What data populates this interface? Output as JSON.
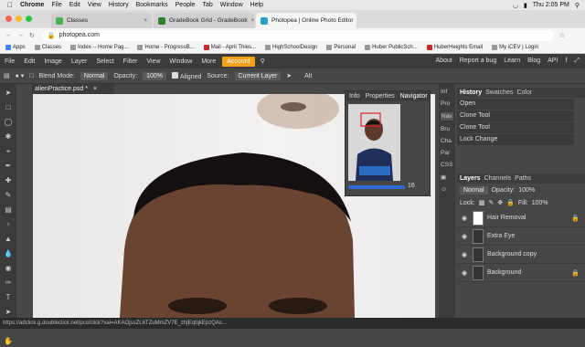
{
  "mac_menu": {
    "app": "Chrome",
    "items": [
      "File",
      "Edit",
      "View",
      "History",
      "Bookmarks",
      "People",
      "Tab",
      "Window",
      "Help"
    ],
    "clock": "Thu 2:05 PM"
  },
  "tabs": [
    {
      "label": "Classes",
      "color": "#4caf50"
    },
    {
      "label": "GradeBook Grid - GradeBook",
      "color": "#2e7d32"
    },
    {
      "label": "Photopea | Online Photo Editor",
      "color": "#27a0c8"
    }
  ],
  "url": "photopea.com",
  "bookmarks": [
    "Apps",
    "Classes",
    "Index -- Home Pag...",
    "Home - ProgressB...",
    "Mail - April Thies...",
    "HighSchoolDesign",
    "Personal",
    "Huber PublicSch...",
    "HuberHeights Email",
    "My iCEV | Login"
  ],
  "menu": {
    "items": [
      "File",
      "Edit",
      "Image",
      "Layer",
      "Select",
      "Filter",
      "View",
      "Window",
      "More"
    ],
    "account": "Account",
    "right": [
      "About",
      "Report a bug",
      "Learn",
      "Blog",
      "API"
    ]
  },
  "options": {
    "blend_label": "Blend Mode:",
    "blend_value": "Normal",
    "opacity_label": "Opacity:",
    "opacity_value": "100%",
    "aligned": "Aligned",
    "source_label": "Source:",
    "source_value": "Current Layer",
    "alt": "Alt"
  },
  "document_tab": "alienPractice.psd *",
  "navigator": {
    "tabs": [
      "Info",
      "Properties",
      "Navigator"
    ],
    "zoom": "16"
  },
  "side_icons": [
    "Inf",
    "Pro",
    "Nav",
    "Bru",
    "Cha",
    "Par",
    "CSS"
  ],
  "history": {
    "tabs": [
      "History",
      "Swatches",
      "Color"
    ],
    "items": [
      "Open",
      "Clone Tool",
      "Clone Tool",
      "Lock Change"
    ]
  },
  "layers": {
    "tabs": [
      "Layers",
      "Channels",
      "Paths"
    ],
    "blend": "Normal",
    "opacity_label": "Opacity:",
    "opacity": "100%",
    "lock_label": "Lock:",
    "fill_label": "Fill:",
    "fill": "100%",
    "items": [
      "Hair Removal",
      "Extra Eye",
      "Background copy",
      "Background"
    ]
  },
  "status_url": "https://adclick.g.doubleclick.net/pcs/click?xai=AKAOjssZL6TZuMmZV7E_zhjEqfqkEpzQAs..."
}
